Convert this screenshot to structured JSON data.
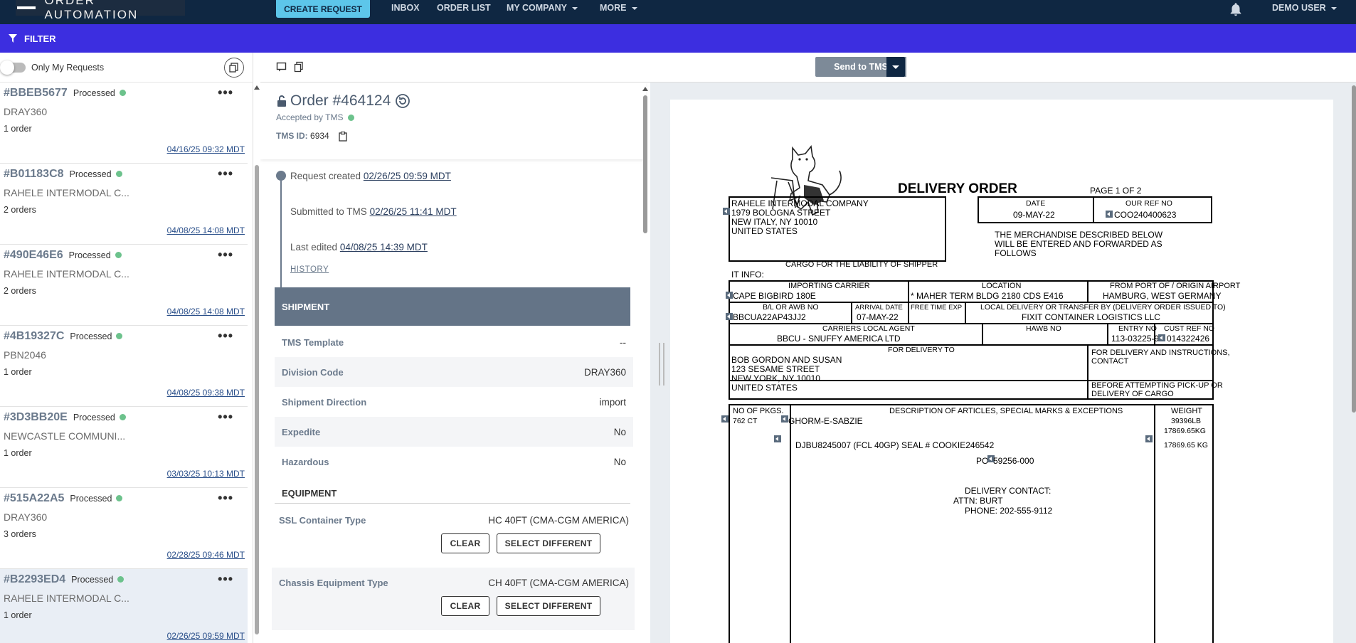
{
  "app": {
    "title": "ORDER AUTOMATION"
  },
  "nav": {
    "create": "CREATE REQUEST",
    "inbox": "INBOX",
    "order_list": "ORDER LIST",
    "my_company": "MY COMPANY",
    "more": "MORE",
    "user": "DEMO USER"
  },
  "filter": {
    "label": "FILTER"
  },
  "left": {
    "toggle_label": "Only My Requests",
    "requests": [
      {
        "id": "#BBEB5677",
        "status": "Processed",
        "name": "DRAY360",
        "count": "1 order",
        "date": "04/16/25 09:32 MDT"
      },
      {
        "id": "#B01183C8",
        "status": "Processed",
        "name": "RAHELE INTERMODAL C...",
        "count": "2 orders",
        "date": "04/08/25 14:08 MDT"
      },
      {
        "id": "#490E46E6",
        "status": "Processed",
        "name": "RAHELE INTERMODAL C...",
        "count": "2 orders",
        "date": "04/08/25 14:08 MDT"
      },
      {
        "id": "#4B19327C",
        "status": "Processed",
        "name": "PBN2046",
        "count": "1 order",
        "date": "04/08/25 09:38 MDT"
      },
      {
        "id": "#3D3BB20E",
        "status": "Processed",
        "name": "NEWCASTLE COMMUNI...",
        "count": "1 order",
        "date": "03/03/25 10:13 MDT"
      },
      {
        "id": "#515A22A5",
        "status": "Processed",
        "name": "DRAY360",
        "count": "3 orders",
        "date": "02/28/25 09:46 MDT"
      },
      {
        "id": "#B2293ED4",
        "status": "Processed",
        "name": "RAHELE INTERMODAL C...",
        "count": "1 order",
        "date": "02/26/25 09:59 MDT"
      }
    ]
  },
  "toolbar": {
    "send": "Send to TMS"
  },
  "order": {
    "title": "Order #464124",
    "accepted": "Accepted by TMS",
    "tms_id_label": "TMS ID:",
    "tms_id": "6934",
    "timeline": {
      "created_label": "Request created",
      "created": "02/26/25 09:59 MDT",
      "submitted_label": "Submitted to TMS",
      "submitted": "02/26/25 11:41 MDT",
      "edited_label": "Last edited",
      "edited": "04/08/25 14:39 MDT",
      "history": "HISTORY"
    },
    "shipment": {
      "header": "SHIPMENT",
      "rows": [
        {
          "k": "TMS Template",
          "v": "--"
        },
        {
          "k": "Division Code",
          "v": "DRAY360"
        },
        {
          "k": "Shipment Direction",
          "v": "import"
        },
        {
          "k": "Expedite",
          "v": "No"
        },
        {
          "k": "Hazardous",
          "v": "No"
        }
      ]
    },
    "equipment": {
      "header": "EQUIPMENT",
      "items": [
        {
          "k": "SSL Container Type",
          "v": "HC 40FT (CMA-CGM AMERICA)"
        },
        {
          "k": "Chassis Equipment Type",
          "v": "CH 40FT (CMA-CGM AMERICA)"
        }
      ],
      "clear": "CLEAR",
      "select": "SELECT DIFFERENT"
    }
  },
  "doc": {
    "title": "DELIVERY ORDER",
    "page": "PAGE 1 OF 2",
    "from": [
      "RAHELE INTERMODAL COMPANY",
      "1979 BOLOGNA STREET",
      "NEW ITALY, NY 10010",
      "UNITED STATES"
    ],
    "date_label": "DATE",
    "date": "09-MAY-22",
    "ref_label": "OUR REF NO",
    "ref": "COO240400623",
    "merch": [
      "THE MERCHANDISE DESCRIBED BELOW",
      "WILL BE ENTERED AND FORWARDED AS",
      "FOLLOWS"
    ],
    "cargo": "CARGO FOR THE LIABILITY OF SHIPPER",
    "itinfo": "IT INFO:",
    "carrier_label": "IMPORTING CARRIER",
    "carrier": "CAPE BIGBIRD 180E",
    "location_label": "LOCATION",
    "location": "* MAHER TERM BLDG 2180 CDS E416",
    "port_label": "FROM PORT OF / ORIGIN AIRPORT",
    "port": "HAMBURG, WEST GERMANY",
    "bl_label": "B/L OR AWB NO",
    "bl": "BBCUA22AP43JJ2",
    "arrival_label": "ARRIVAL DATE",
    "arrival": "07-MAY-22",
    "freetime_label": "FREE TIME EXP",
    "local_label": "LOCAL DELIVERY OR TRANSFER BY (DELIVERY ORDER ISSUED TO)",
    "local": "FIXIT CONTAINER LOGISTICS LLC",
    "agent_label": "CARRIERS LOCAL AGENT",
    "agent": "BBCU - SNUFFY AMERICA LTD",
    "hawb_label": "HAWB NO",
    "entry_label": "ENTRY NO",
    "entry": "113-03225-9",
    "cust_label": "CUST REF NO",
    "cust": "014322426",
    "deliver_label": "FOR DELIVERY TO",
    "deliver": [
      "BOB GORDON AND SUSAN",
      "123 SESAME STREET",
      "NEW YORK, NY 10010",
      "UNITED STATES"
    ],
    "instr": [
      "FOR DELIVERY AND INSTRUCTIONS,",
      "CONTACT"
    ],
    "before": [
      "BEFORE ATTEMPTING PICK-UP OR",
      "DELIVERY OF CARGO"
    ],
    "pkgs_label": "NO OF PKGS.",
    "pkgs": "762 CT",
    "desc_label": "DESCRIPTION OF ARTICLES, SPECIAL MARKS & EXCEPTIONS",
    "weight_label": "WEIGHT",
    "weights": [
      "39396LB",
      "17869.65KG",
      "17869.65 KG"
    ],
    "desc1": "GHORM-E-SABZIE",
    "desc2": "DJBU8245007 (FCL 40GP) SEAL # COOKIE246542",
    "po": "PO",
    "po_num": "59256-000",
    "contact": [
      "DELIVERY CONTACT:",
      "ATTN: BURT",
      "PHONE: 202-555-9112"
    ]
  }
}
